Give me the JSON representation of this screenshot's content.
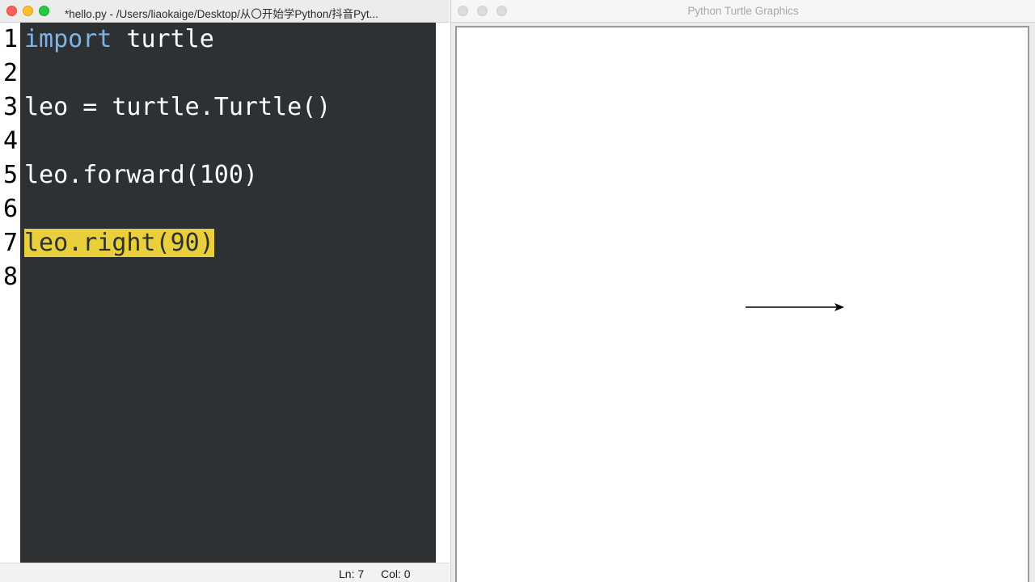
{
  "editor": {
    "title": "*hello.py - /Users/liaokaige/Desktop/从〇开始学Python/抖音Pyt...",
    "lines": [
      {
        "number": "1",
        "keyword": "import",
        "text": " turtle"
      },
      {
        "number": "2",
        "text": ""
      },
      {
        "number": "3",
        "text": "leo = turtle.Turtle()"
      },
      {
        "number": "4",
        "text": ""
      },
      {
        "number": "5",
        "text": "leo.forward(100)"
      },
      {
        "number": "6",
        "text": ""
      },
      {
        "number": "7",
        "text": "leo.right(90)",
        "highlighted": true
      },
      {
        "number": "8",
        "text": ""
      }
    ],
    "status": {
      "line": "Ln: 7",
      "col": "Col: 0"
    },
    "colors": {
      "background": "#2e3134",
      "keyword": "#7fb3e8",
      "highlight": "#e9cf3c"
    }
  },
  "turtle_window": {
    "title": "Python Turtle Graphics",
    "drawing": {
      "forward_distance": 100,
      "heading_after_turn": "east",
      "line_color": "#000000"
    }
  }
}
